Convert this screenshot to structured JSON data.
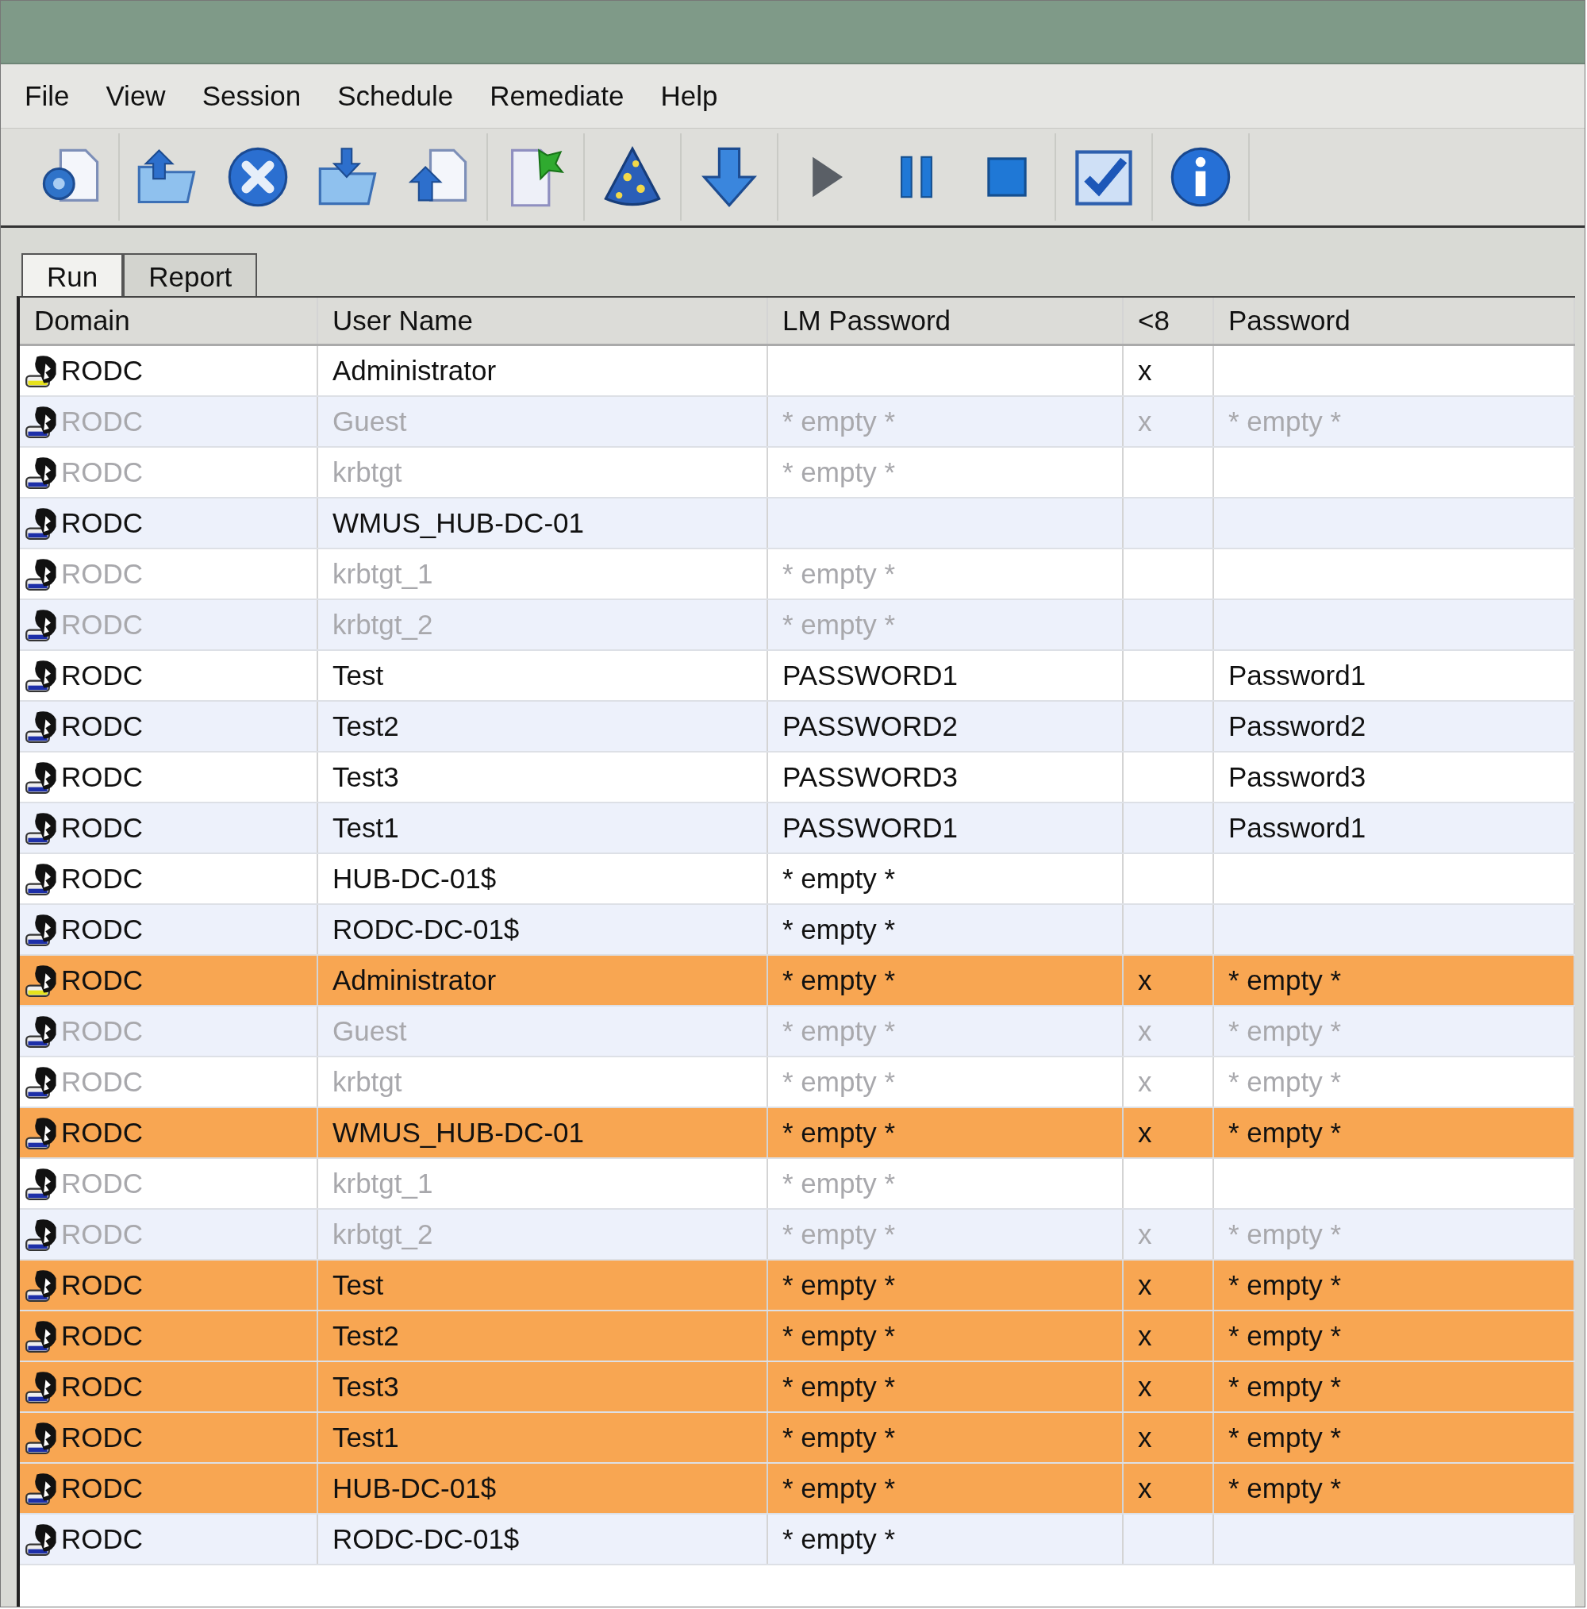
{
  "menu": [
    "File",
    "View",
    "Session",
    "Schedule",
    "Remediate",
    "Help"
  ],
  "tabs": [
    {
      "label": "Run",
      "selected": true
    },
    {
      "label": "Report",
      "selected": false
    }
  ],
  "table": {
    "columns": [
      "Domain",
      "User Name",
      "LM Password",
      "<8",
      "Password"
    ],
    "rows": [
      {
        "domain": "RODC",
        "user": "Administrator",
        "lm": "",
        "lt8": "x",
        "password": "",
        "disabled": false,
        "highlighted": false,
        "admin": true
      },
      {
        "domain": "RODC",
        "user": "Guest",
        "lm": "* empty *",
        "lt8": "x",
        "password": "* empty *",
        "disabled": true,
        "highlighted": false,
        "admin": false
      },
      {
        "domain": "RODC",
        "user": "krbtgt",
        "lm": "* empty *",
        "lt8": "",
        "password": "",
        "disabled": true,
        "highlighted": false,
        "admin": false
      },
      {
        "domain": "RODC",
        "user": "WMUS_HUB-DC-01",
        "lm": "",
        "lt8": "",
        "password": "",
        "disabled": false,
        "highlighted": false,
        "admin": false
      },
      {
        "domain": "RODC",
        "user": "krbtgt_1",
        "lm": "* empty *",
        "lt8": "",
        "password": "",
        "disabled": true,
        "highlighted": false,
        "admin": false
      },
      {
        "domain": "RODC",
        "user": "krbtgt_2",
        "lm": "* empty *",
        "lt8": "",
        "password": "",
        "disabled": true,
        "highlighted": false,
        "admin": false
      },
      {
        "domain": "RODC",
        "user": "Test",
        "lm": "PASSWORD1",
        "lt8": "",
        "password": "Password1",
        "disabled": false,
        "highlighted": false,
        "admin": false
      },
      {
        "domain": "RODC",
        "user": "Test2",
        "lm": "PASSWORD2",
        "lt8": "",
        "password": "Password2",
        "disabled": false,
        "highlighted": false,
        "admin": false
      },
      {
        "domain": "RODC",
        "user": "Test3",
        "lm": "PASSWORD3",
        "lt8": "",
        "password": "Password3",
        "disabled": false,
        "highlighted": false,
        "admin": false
      },
      {
        "domain": "RODC",
        "user": "Test1",
        "lm": "PASSWORD1",
        "lt8": "",
        "password": "Password1",
        "disabled": false,
        "highlighted": false,
        "admin": false
      },
      {
        "domain": "RODC",
        "user": "HUB-DC-01$",
        "lm": "* empty *",
        "lt8": "",
        "password": "",
        "disabled": false,
        "highlighted": false,
        "admin": false
      },
      {
        "domain": "RODC",
        "user": "RODC-DC-01$",
        "lm": "* empty *",
        "lt8": "",
        "password": "",
        "disabled": false,
        "highlighted": false,
        "admin": false
      },
      {
        "domain": "RODC",
        "user": "Administrator",
        "lm": "* empty *",
        "lt8": "x",
        "password": "* empty *",
        "disabled": false,
        "highlighted": true,
        "admin": true
      },
      {
        "domain": "RODC",
        "user": "Guest",
        "lm": "* empty *",
        "lt8": "x",
        "password": "* empty *",
        "disabled": true,
        "highlighted": false,
        "admin": false
      },
      {
        "domain": "RODC",
        "user": "krbtgt",
        "lm": "* empty *",
        "lt8": "x",
        "password": "* empty *",
        "disabled": true,
        "highlighted": false,
        "admin": false
      },
      {
        "domain": "RODC",
        "user": "WMUS_HUB-DC-01",
        "lm": "* empty *",
        "lt8": "x",
        "password": "* empty *",
        "disabled": false,
        "highlighted": true,
        "admin": false
      },
      {
        "domain": "RODC",
        "user": "krbtgt_1",
        "lm": "* empty *",
        "lt8": "",
        "password": "",
        "disabled": true,
        "highlighted": false,
        "admin": false
      },
      {
        "domain": "RODC",
        "user": "krbtgt_2",
        "lm": "* empty *",
        "lt8": "x",
        "password": "* empty *",
        "disabled": true,
        "highlighted": false,
        "admin": false
      },
      {
        "domain": "RODC",
        "user": "Test",
        "lm": "* empty *",
        "lt8": "x",
        "password": "* empty *",
        "disabled": false,
        "highlighted": true,
        "admin": false
      },
      {
        "domain": "RODC",
        "user": "Test2",
        "lm": "* empty *",
        "lt8": "x",
        "password": "* empty *",
        "disabled": false,
        "highlighted": true,
        "admin": false
      },
      {
        "domain": "RODC",
        "user": "Test3",
        "lm": "* empty *",
        "lt8": "x",
        "password": "* empty *",
        "disabled": false,
        "highlighted": true,
        "admin": false
      },
      {
        "domain": "RODC",
        "user": "Test1",
        "lm": "* empty *",
        "lt8": "x",
        "password": "* empty *",
        "disabled": false,
        "highlighted": true,
        "admin": false
      },
      {
        "domain": "RODC",
        "user": "HUB-DC-01$",
        "lm": "* empty *",
        "lt8": "x",
        "password": "* empty *",
        "disabled": false,
        "highlighted": true,
        "admin": false
      },
      {
        "domain": "RODC",
        "user": "RODC-DC-01$",
        "lm": "* empty *",
        "lt8": "",
        "password": "",
        "disabled": false,
        "highlighted": false,
        "admin": false
      }
    ]
  }
}
